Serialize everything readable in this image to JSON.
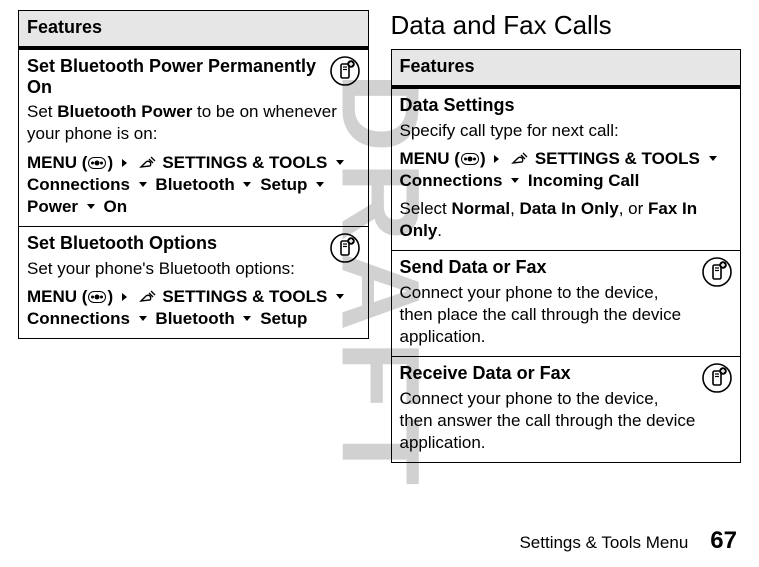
{
  "watermark": "DRAFT",
  "left": {
    "table_header": "Features",
    "rows": [
      {
        "title": "Set Bluetooth Power Permanently On",
        "body_pre": "Set ",
        "body_em": "Bluetooth Power",
        "body_post": " to be on whenever your phone is on:",
        "menu_label": "MENU",
        "settings_label": "SETTINGS & TOOLS",
        "path": [
          "Connections",
          "Bluetooth",
          "Setup",
          "Power",
          "On"
        ]
      },
      {
        "title": "Set Bluetooth Options",
        "body": "Set your phone's Bluetooth options:",
        "menu_label": "MENU",
        "settings_label": "SETTINGS & TOOLS",
        "path": [
          "Connections",
          "Bluetooth",
          "Setup"
        ]
      }
    ]
  },
  "right": {
    "section_title": "Data and Fax Calls",
    "table_header": "Features",
    "rows": [
      {
        "title": "Data Settings",
        "body": "Specify call type for next call:",
        "menu_label": "MENU",
        "settings_label": "SETTINGS & TOOLS",
        "path": [
          "Connections",
          "Incoming Call"
        ],
        "select_pre": "Select ",
        "select_opts": [
          "Normal",
          "Data In Only",
          "Fax In Only"
        ],
        "select_sep1": ", ",
        "select_sep2": ", or ",
        "select_end": "."
      },
      {
        "title": "Send Data or Fax",
        "body": "Connect your phone to the device, then place the call through the device application."
      },
      {
        "title": "Receive Data or Fax",
        "body": "Connect your phone to the device, then answer the call through the device application."
      }
    ]
  },
  "footer": {
    "label": "Settings & Tools Menu",
    "page": "67"
  }
}
